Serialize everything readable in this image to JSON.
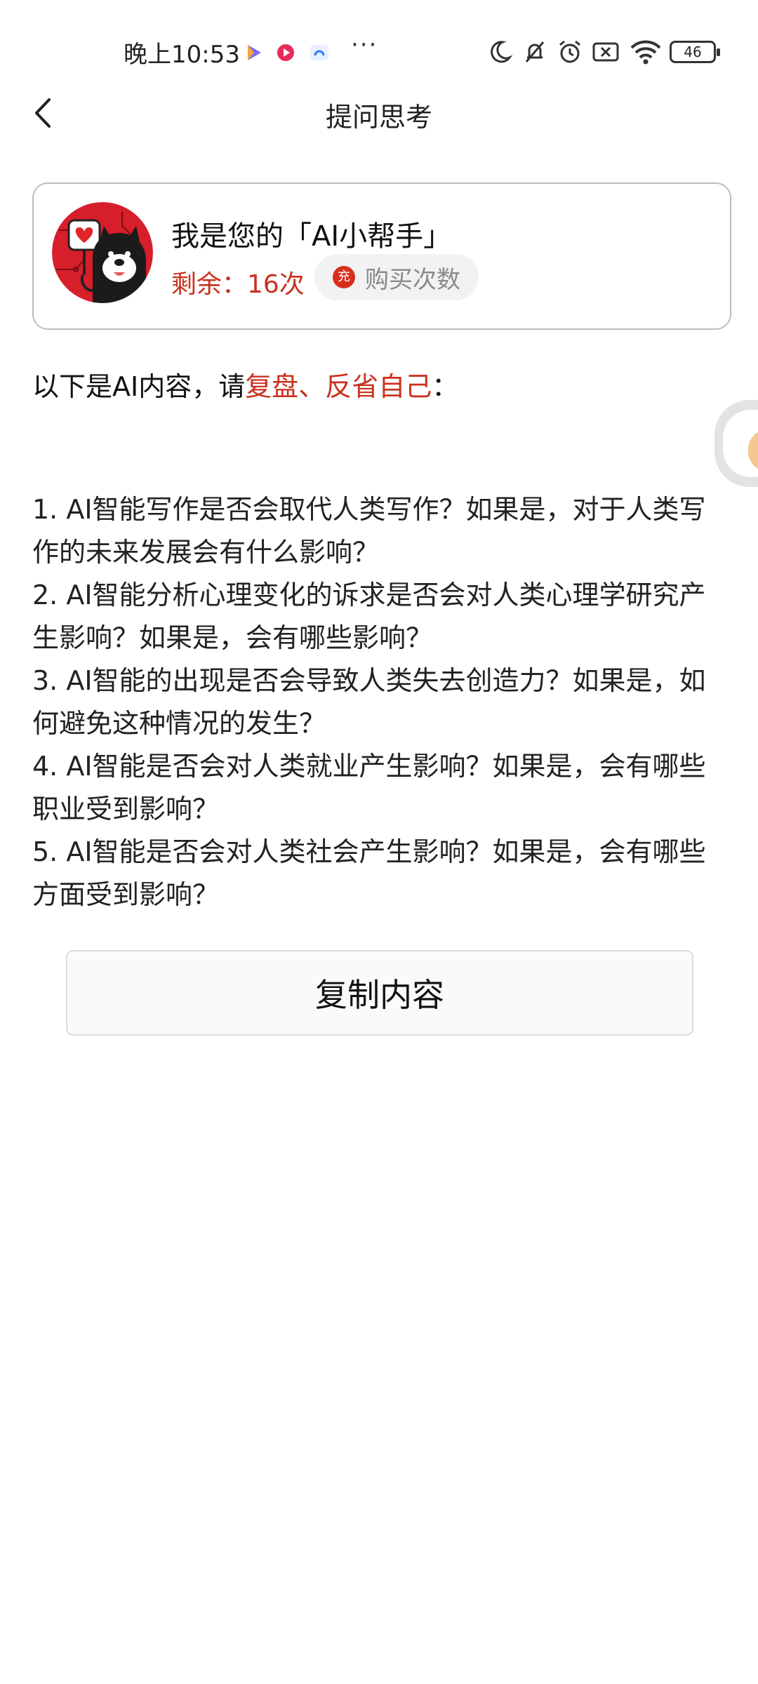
{
  "status_bar": {
    "time": "晚上10:53",
    "more": "···",
    "battery": "46"
  },
  "nav": {
    "title": "提问思考"
  },
  "card": {
    "title": "我是您的「AI小帮手」",
    "remaining": "剩余：16次",
    "buy_icon_text": "充",
    "buy_label": "购买次数"
  },
  "intro": {
    "prefix": "以下是AI内容，请",
    "highlight": "复盘、反省自己",
    "suffix": "："
  },
  "content": {
    "items": [
      "1. AI智能写作是否会取代人类写作？如果是，对于人类写作的未来发展会有什么影响？",
      "2. AI智能分析心理变化的诉求是否会对人类心理学研究产生影响？如果是，会有哪些影响？",
      "3. AI智能的出现是否会导致人类失去创造力？如果是，如何避免这种情况的发生？",
      "4. AI智能是否会对人类就业产生影响？如果是，会有哪些职业受到影响？",
      "5. AI智能是否会对人类社会产生影响？如果是，会有哪些方面受到影响？"
    ]
  },
  "copy_button": {
    "label": "复制内容"
  },
  "colors": {
    "accent_red": "#c9311e",
    "buy_icon_red": "#d72f1c"
  }
}
